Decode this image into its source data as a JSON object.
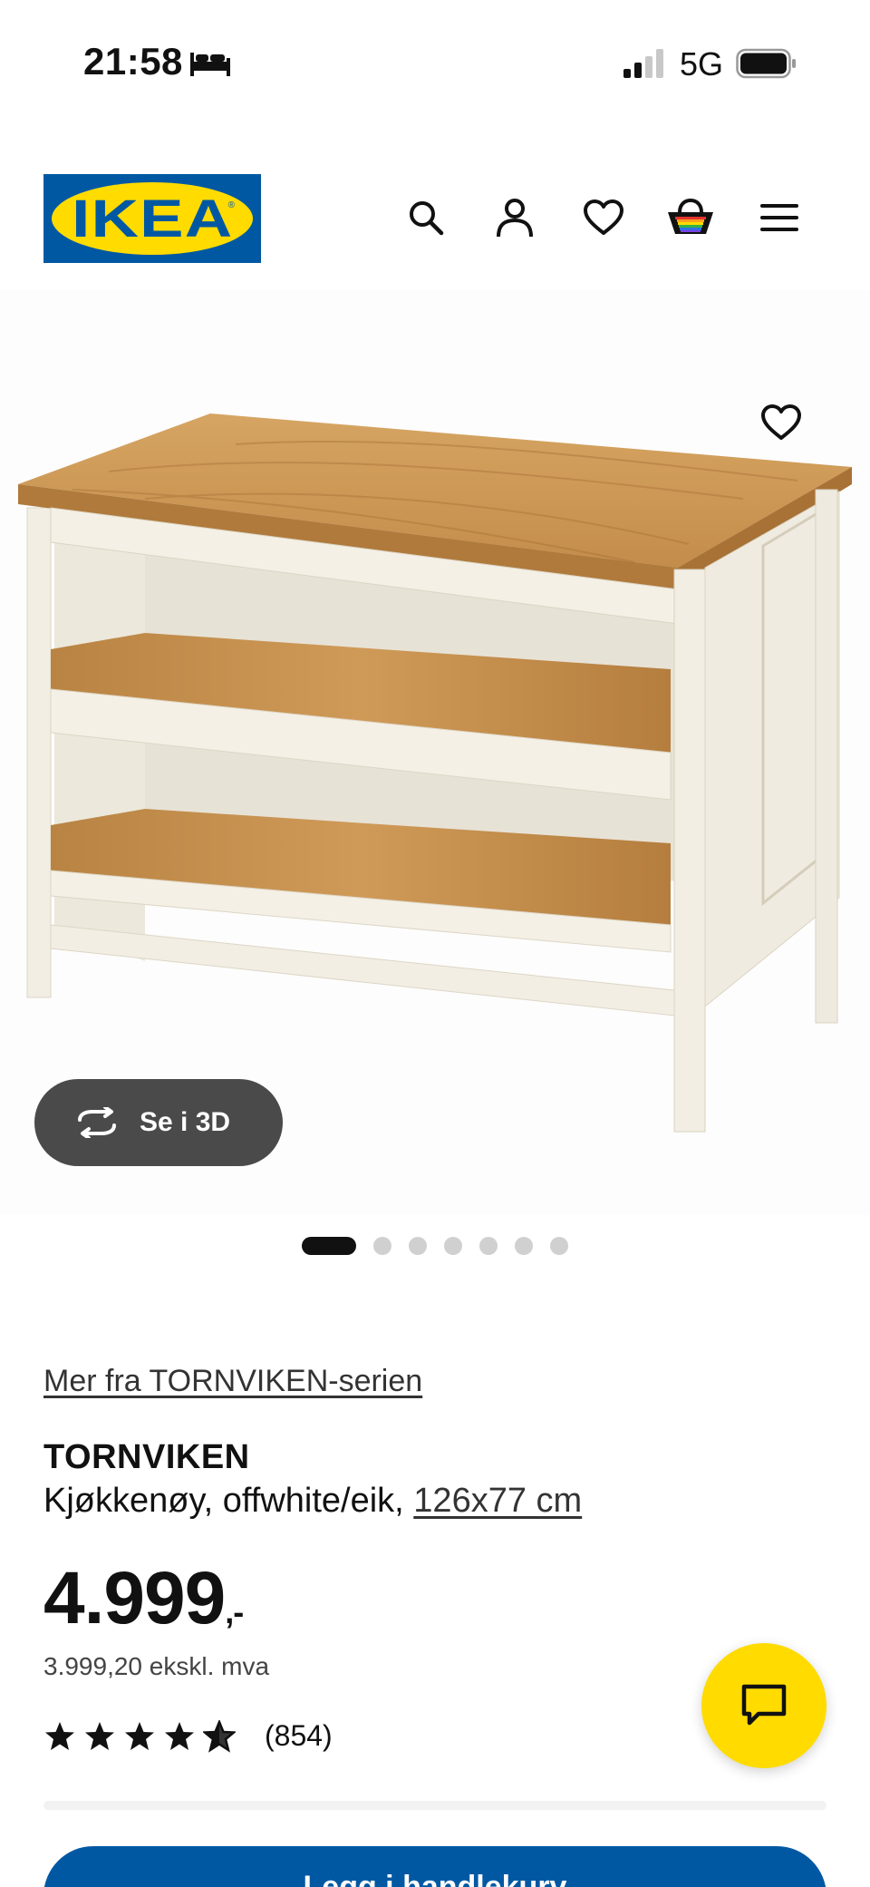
{
  "status_bar": {
    "time": "21:58",
    "network": "5G",
    "icons": [
      "bed-icon",
      "signal-icon",
      "battery-icon"
    ]
  },
  "header": {
    "logo_text": "IKEA",
    "logo_reg": "®",
    "nav_icons": [
      "search-icon",
      "account-icon",
      "heart-icon",
      "cart-icon",
      "menu-icon"
    ]
  },
  "hero": {
    "view_3d_label": "Se i 3D",
    "carousel_total": 7,
    "carousel_active": 1
  },
  "product": {
    "series_link": "Mer fra TORNVIKEN-serien",
    "name": "TORNVIKEN",
    "description": "Kjøkkenøy, offwhite/eik, ",
    "size": "126x77 cm",
    "price": "4.999",
    "price_suffix": ",-",
    "price_ex_vat": "3.999,20 ekskl. mva",
    "rating_stars": 4.5,
    "rating_count": "(854)"
  },
  "actions": {
    "cart_label": "Legg i handlekurv"
  },
  "colors": {
    "brand_blue": "#0058a3",
    "brand_yellow": "#ffdb00",
    "wood": "#c8924f",
    "offwhite": "#f3efe4"
  }
}
